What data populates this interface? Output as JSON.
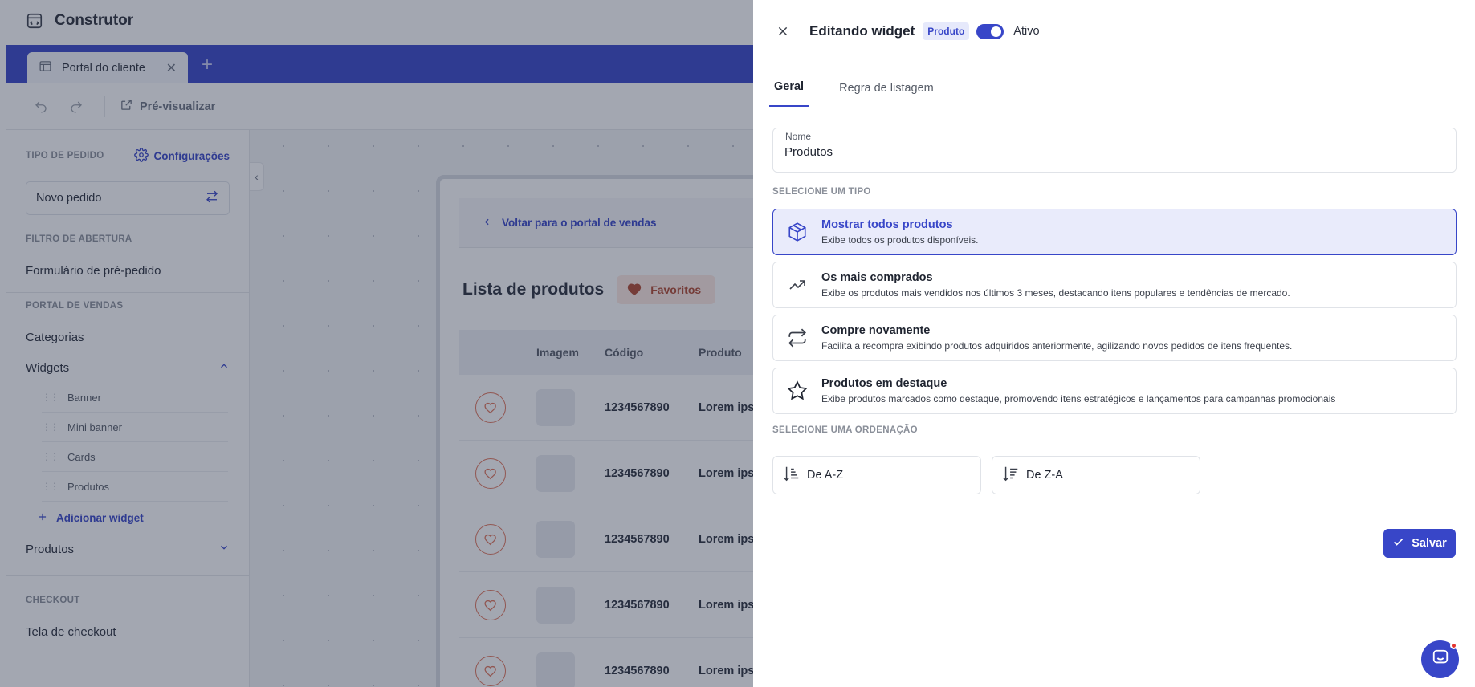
{
  "app": {
    "title": "Construtor",
    "tab_label": "Portal do cliente",
    "toolbar": {
      "preview_label": "Pré-visualizar"
    }
  },
  "sidebar": {
    "order_type_label": "TIPO DE PEDIDO",
    "config_label": "Configurações",
    "order_type_value": "Novo pedido",
    "sections": {
      "opening_filter": "FILTRO DE ABERTURA",
      "sales_portal": "PORTAL DE VENDAS",
      "checkout": "CHECKOUT"
    },
    "items": {
      "pre_order_form": "Formulário de pré-pedido",
      "categories": "Categorias",
      "widgets": "Widgets",
      "products": "Produtos",
      "checkout_screen": "Tela de checkout"
    },
    "widgets": [
      "Banner",
      "Mini banner",
      "Cards",
      "Produtos"
    ],
    "add_widget": "Adicionar widget"
  },
  "preview": {
    "back_label": "Voltar para o portal de vendas",
    "list_title": "Lista de produtos",
    "favorites_label": "Favoritos",
    "columns": {
      "image": "Imagem",
      "code": "Código",
      "product": "Produto"
    },
    "rows": [
      {
        "code": "1234567890",
        "product": "Lorem ips"
      },
      {
        "code": "1234567890",
        "product": "Lorem ips"
      },
      {
        "code": "1234567890",
        "product": "Lorem ips"
      },
      {
        "code": "1234567890",
        "product": "Lorem ips"
      },
      {
        "code": "1234567890",
        "product": "Lorem ips"
      }
    ]
  },
  "panel": {
    "title": "Editando widget",
    "badge": "Produto",
    "active_label": "Ativo",
    "active": true,
    "tabs": [
      "Geral",
      "Regra de listagem"
    ],
    "name_label": "Nome",
    "name_value": "Produtos",
    "type_section": "SELECIONE UM TIPO",
    "types": [
      {
        "icon": "box-icon",
        "title": "Mostrar todos produtos",
        "desc": "Exibe todos os produtos disponíveis.",
        "selected": true
      },
      {
        "icon": "trending-up-icon",
        "title": "Os mais comprados",
        "desc": "Exibe os produtos mais vendidos nos últimos 3 meses, destacando itens populares e tendências de mercado.",
        "selected": false
      },
      {
        "icon": "repeat-icon",
        "title": "Compre novamente",
        "desc": "Facilita a recompra exibindo produtos adquiridos anteriormente, agilizando novos pedidos de itens frequentes.",
        "selected": false
      },
      {
        "icon": "star-icon",
        "title": "Produtos em destaque",
        "desc": "Exibe produtos marcados como destaque, promovendo itens estratégicos e lançamentos para campanhas promocionais",
        "selected": false
      }
    ],
    "order_section": "SELECIONE UMA ORDENAÇÃO",
    "orders": [
      "De A-Z",
      "De Z-A"
    ],
    "save_label": "Salvar"
  },
  "colors": {
    "accent": "#3846c8",
    "selected_bg": "#e9ebfb",
    "favorite": "#e0745a"
  }
}
